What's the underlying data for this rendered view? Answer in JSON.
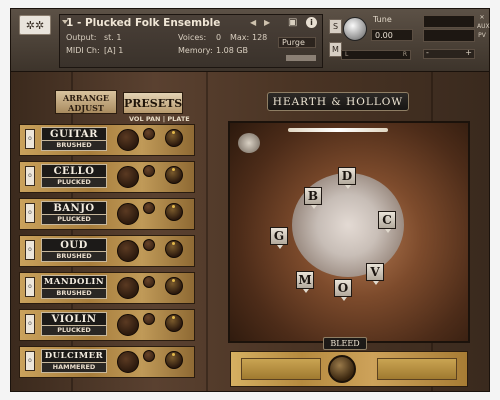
{
  "header": {
    "logo_glyph": "✲✲",
    "instrument_name": "1 - Plucked Folk Ensemble",
    "output_label": "Output:",
    "output_value": "st. 1",
    "voices_label": "Voices:",
    "voices_value": "0",
    "max_label": "Max:",
    "max_value": "128",
    "midi_label": "MIDI Ch:",
    "midi_value": "[A] 1",
    "memory_label": "Memory:",
    "memory_value": "1.08 GB",
    "purge_label": "Purge",
    "prev_arrow": "◀",
    "next_arrow": "▶",
    "camera_glyph": "📷",
    "info_glyph": "i",
    "solo_label": "S",
    "mute_label": "M",
    "tune_label": "Tune",
    "tune_value": "0.00",
    "lr_left": "L",
    "lr_right": "R",
    "vol_minus": "-",
    "vol_plus": "+",
    "close_glyph": "✕",
    "aux_label": "AUX",
    "pv_label": "PV"
  },
  "left_panel": {
    "arrange_label": "ARRANGE",
    "adjust_label": "ADJUST",
    "presets_label": "PRESETS",
    "column_header": "VOL  PAN | PLATE",
    "rows": [
      {
        "name": "GUITAR",
        "style": "BRUSHED"
      },
      {
        "name": "CELLO",
        "style": "PLUCKED"
      },
      {
        "name": "BANJO",
        "style": "PLUCKED"
      },
      {
        "name": "OUD",
        "style": "BRUSHED"
      },
      {
        "name": "MANDOLIN",
        "style": "BRUSHED"
      },
      {
        "name": "VIOLIN",
        "style": "PLUCKED"
      },
      {
        "name": "DULCIMER",
        "style": "HAMMERED"
      }
    ]
  },
  "right_panel": {
    "title": "HEARTH & HOLLOW",
    "mics": [
      "D",
      "B",
      "C",
      "G",
      "V",
      "M",
      "O"
    ],
    "bleed_label": "BLEED"
  }
}
